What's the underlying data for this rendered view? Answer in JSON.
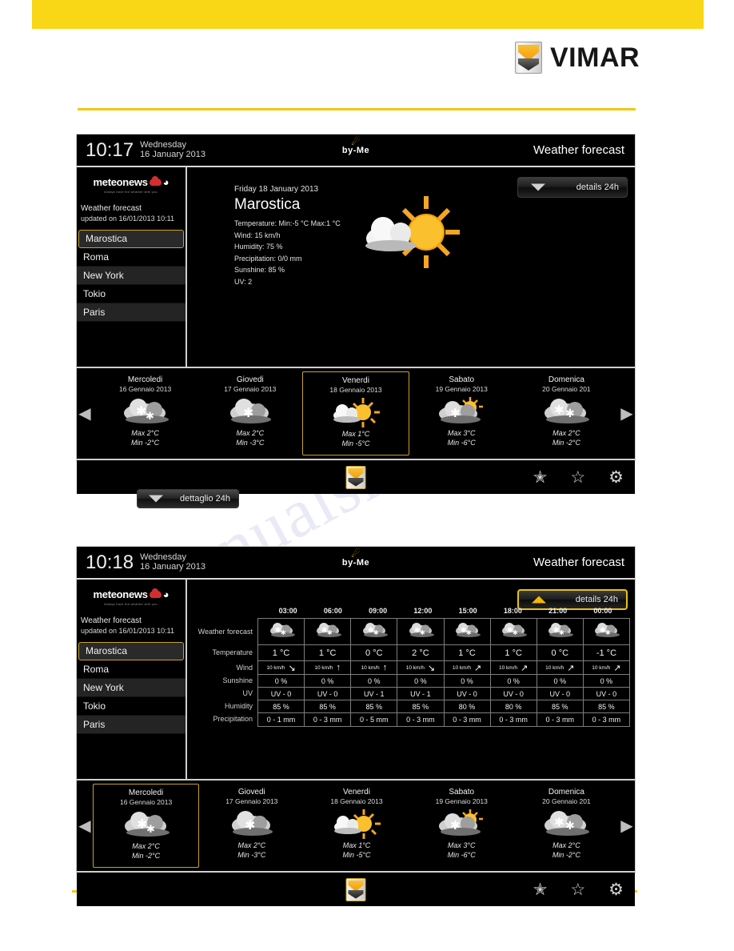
{
  "page": {
    "vimar_brand": "VIMAR",
    "watermark": "manualshive.com"
  },
  "panel1": {
    "statusbar": {
      "time": "10:17",
      "day_name": "Wednesday",
      "day_date": "16 January 2013",
      "logo_text": "by-Me",
      "title": "Weather forecast"
    },
    "sidebar": {
      "logo_name": "meteonews",
      "logo_tagline": "Always have the weather with you.",
      "heading": "Weather forecast",
      "subheading": "updated on 16/01/2013 10:11",
      "cities": [
        {
          "label": "Marostica",
          "selected": true
        },
        {
          "label": "Roma",
          "selected": false
        },
        {
          "label": "New York",
          "selected": false
        },
        {
          "label": "Tokio",
          "selected": false
        },
        {
          "label": "Paris",
          "selected": false
        }
      ]
    },
    "details_button": {
      "label": "details 24h",
      "state": "collapsed",
      "arrow": "chevron-down-icon"
    },
    "summary": {
      "date": "Friday 18 January 2013",
      "city": "Marostica",
      "lines": [
        "Temperature: Min:-5 °C  Max:1 °C",
        "Wind: 15 km/h",
        "Humidity: 75 %",
        "Precipitation: 0/0 mm",
        "Sunshine: 85 %",
        "UV: 2"
      ],
      "icon": "sun-behind-cloud-icon"
    },
    "days": [
      {
        "name": "Mercoledi",
        "date": "16 Gennaio 2013",
        "icon": "snow-cloud-icon",
        "max": "Max 2°C",
        "min": "Min -2°C",
        "selected": false
      },
      {
        "name": "Giovedi",
        "date": "17 Gennaio 2013",
        "icon": "snow-cloud-icon",
        "max": "Max 2°C",
        "min": "Min -3°C",
        "selected": false
      },
      {
        "name": "Venerdi",
        "date": "18 Gennaio 2013",
        "icon": "sun-behind-cloud-icon",
        "max": "Max 1°C",
        "min": "Min -5°C",
        "selected": true
      },
      {
        "name": "Sabato",
        "date": "19 Gennaio 2013",
        "icon": "sun-cloud-snow-icon",
        "max": "Max 3°C",
        "min": "Min -6°C",
        "selected": false
      },
      {
        "name": "Domenica",
        "date": "20 Gennaio 201",
        "icon": "snow-cloud-icon",
        "max": "Max 2°C",
        "min": "Min -2°C",
        "selected": false
      }
    ],
    "nav": {
      "prev": "prev-arrow-icon",
      "next": "next-arrow-icon"
    },
    "toolbar": {
      "home": "vimar-home-icon",
      "icons": [
        "star-lightning-icon",
        "star-icon",
        "gear-icon"
      ]
    }
  },
  "mid_button": {
    "label": "dettaglio 24h",
    "arrow": "chevron-down-icon"
  },
  "panel2": {
    "statusbar": {
      "time": "10:18",
      "day_name": "Wednesday",
      "day_date": "16 January 2013",
      "logo_text": "by-Me",
      "title": "Weather forecast"
    },
    "sidebar": {
      "logo_name": "meteonews",
      "logo_tagline": "Always have the weather with you.",
      "heading": "Weather forecast",
      "subheading": "updated on 16/01/2013 10:11",
      "cities": [
        {
          "label": "Marostica",
          "selected": true
        },
        {
          "label": "Roma",
          "selected": false
        },
        {
          "label": "New York",
          "selected": false
        },
        {
          "label": "Tokio",
          "selected": false
        },
        {
          "label": "Paris",
          "selected": false
        }
      ]
    },
    "details_button": {
      "label": "details 24h",
      "state": "expanded",
      "arrow": "chevron-up-icon"
    },
    "detail_table": {
      "times": [
        "03:00",
        "06:00",
        "09:00",
        "12:00",
        "15:00",
        "18:00",
        "21:00",
        "00:00"
      ],
      "row_labels": [
        "Weather forecast",
        "Temperature",
        "Wind",
        "Sunshine",
        "UV",
        "Humidity",
        "Precipitation"
      ],
      "weather_icons": [
        "snow-cloud-icon",
        "snow-cloud-icon",
        "snow-cloud-icon",
        "snow-cloud-icon",
        "snow-cloud-icon",
        "snow-cloud-icon",
        "snow-cloud-icon",
        "snow-cloud-icon"
      ],
      "temperature": [
        "1 °C",
        "1 °C",
        "0 °C",
        "2 °C",
        "1 °C",
        "1 °C",
        "0 °C",
        "-1 °C"
      ],
      "wind_speed": [
        "10 km/h",
        "10 km/h",
        "10 km/h",
        "10 km/h",
        "10 km/h",
        "10 km/h",
        "10 km/h",
        "10 km/h"
      ],
      "wind_dir": [
        "↘",
        "↑",
        "↑",
        "↘",
        "↗",
        "↗",
        "↗",
        "↗"
      ],
      "sunshine": [
        "0 %",
        "0 %",
        "0 %",
        "0 %",
        "0 %",
        "0 %",
        "0 %",
        "0 %"
      ],
      "uv": [
        "UV - 0",
        "UV - 0",
        "UV - 1",
        "UV - 1",
        "UV - 0",
        "UV - 0",
        "UV - 0",
        "UV - 0"
      ],
      "humidity": [
        "85 %",
        "85 %",
        "85 %",
        "85 %",
        "80 %",
        "80 %",
        "85 %",
        "85 %"
      ],
      "precipitation": [
        "0 - 1 mm",
        "0 - 3 mm",
        "0 - 5 mm",
        "0 - 3 mm",
        "0 - 3 mm",
        "0 - 3 mm",
        "0 - 3 mm",
        "0 - 3 mm"
      ]
    },
    "days": [
      {
        "name": "Mercoledi",
        "date": "16 Gennaio 2013",
        "icon": "snow-cloud-icon",
        "max": "Max 2°C",
        "min": "Min -2°C",
        "selected": true
      },
      {
        "name": "Giovedi",
        "date": "17 Gennaio 2013",
        "icon": "snow-cloud-icon",
        "max": "Max 2°C",
        "min": "Min -3°C",
        "selected": false
      },
      {
        "name": "Venerdi",
        "date": "18 Gennaio 2013",
        "icon": "sun-behind-cloud-icon",
        "max": "Max 1°C",
        "min": "Min -5°C",
        "selected": false
      },
      {
        "name": "Sabato",
        "date": "19 Gennaio 2013",
        "icon": "sun-cloud-snow-icon",
        "max": "Max 3°C",
        "min": "Min -6°C",
        "selected": false
      },
      {
        "name": "Domenica",
        "date": "20 Gennaio 201",
        "icon": "snow-cloud-icon",
        "max": "Max 2°C",
        "min": "Min -2°C",
        "selected": false
      }
    ],
    "nav": {
      "prev": "prev-arrow-icon",
      "next": "next-arrow-icon"
    },
    "toolbar": {
      "home": "vimar-home-icon",
      "icons": [
        "star-lightning-icon",
        "star-icon",
        "gear-icon"
      ]
    }
  },
  "colors": {
    "brand_yellow": "#F9D616",
    "rule_yellow": "#F2C811",
    "selection_gold": "#C9A227",
    "screen_black": "#000000"
  }
}
